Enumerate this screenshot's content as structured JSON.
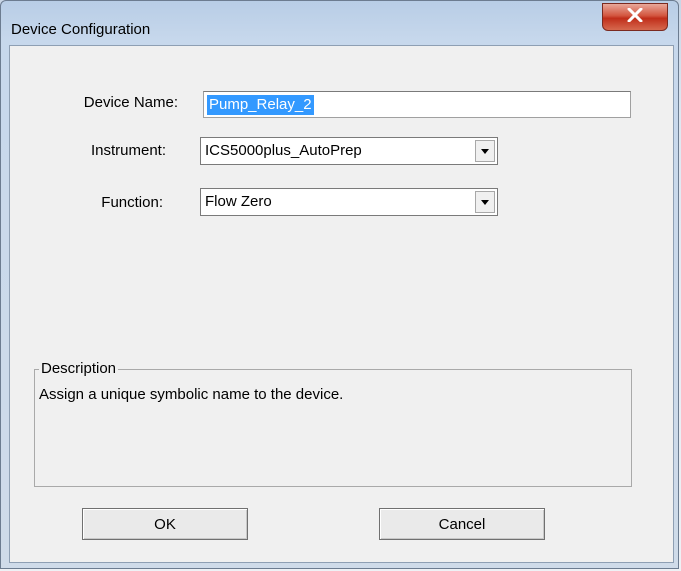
{
  "window": {
    "title": "Device Configuration"
  },
  "form": {
    "device_name": {
      "label": "Device Name:",
      "value": "Pump_Relay_2"
    },
    "instrument": {
      "label": "Instrument:",
      "value": "ICS5000plus_AutoPrep"
    },
    "function": {
      "label": "Function:",
      "value": "Flow Zero"
    }
  },
  "description": {
    "title": "Description",
    "text": "Assign a unique symbolic name to the device."
  },
  "buttons": {
    "ok": "OK",
    "cancel": "Cancel"
  },
  "colors": {
    "selection": "#3399ff",
    "close_button": "#c8412a"
  }
}
